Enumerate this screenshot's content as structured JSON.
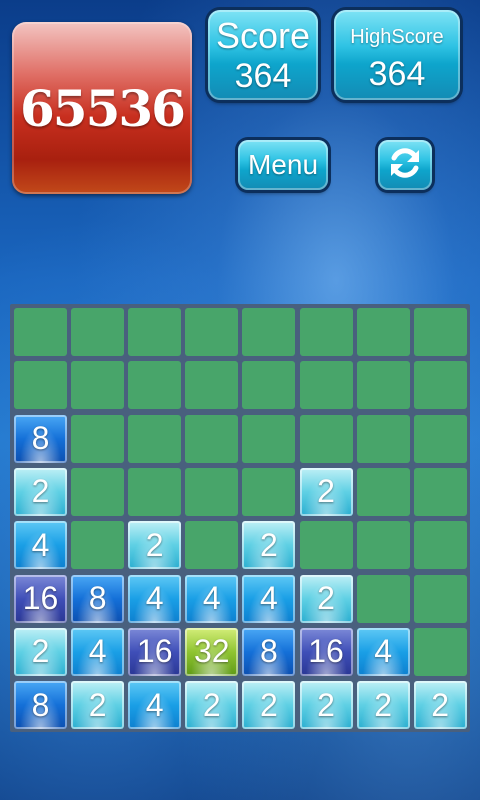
{
  "logo": {
    "text": "65536"
  },
  "score": {
    "label": "Score",
    "value": "364"
  },
  "high_score": {
    "label": "HighScore",
    "value": "364"
  },
  "menu": {
    "label": "Menu"
  },
  "refresh": {
    "icon": "refresh-icon"
  },
  "board": {
    "rows": 8,
    "cols": 8,
    "empty_color": "#48a56a",
    "grid": [
      [
        "",
        "",
        "",
        "",
        "",
        "",
        "",
        ""
      ],
      [
        "",
        "",
        "",
        "",
        "",
        "",
        "",
        ""
      ],
      [
        "8",
        "",
        "",
        "",
        "",
        "",
        "",
        ""
      ],
      [
        "2",
        "",
        "",
        "",
        "",
        "2",
        "",
        ""
      ],
      [
        "4",
        "",
        "2",
        "",
        "2",
        "",
        "",
        ""
      ],
      [
        "16",
        "8",
        "4",
        "4",
        "4",
        "2",
        "",
        ""
      ],
      [
        "2",
        "4",
        "16",
        "32",
        "8",
        "16",
        "4",
        ""
      ],
      [
        "8",
        "2",
        "4",
        "2",
        "2",
        "2",
        "2",
        "2"
      ]
    ]
  }
}
